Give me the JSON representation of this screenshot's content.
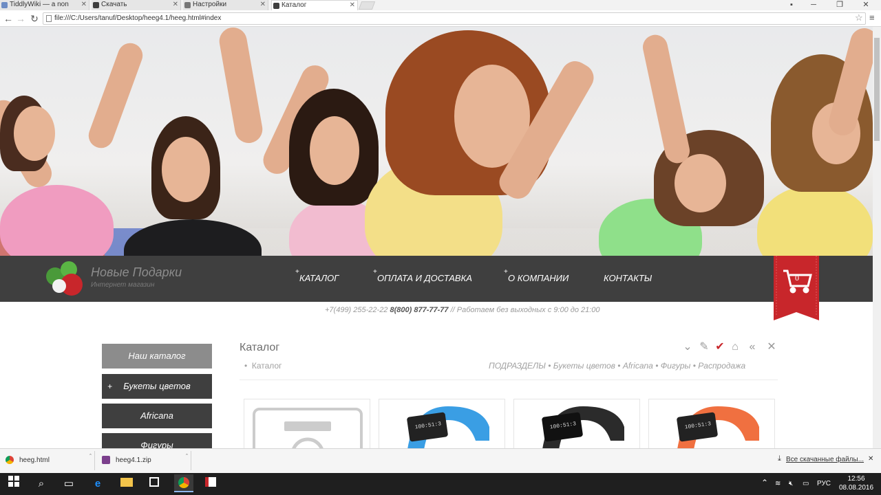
{
  "browser": {
    "tabs": [
      {
        "label": "TiddlyWiki — a non",
        "active": false,
        "icon_color": "#6d8cc4"
      },
      {
        "label": "Скачать",
        "active": false,
        "icon_color": "#3e3e3e"
      },
      {
        "label": "Настройки",
        "active": false,
        "icon_color": "#777777"
      },
      {
        "label": "Каталог",
        "active": true,
        "icon_color": "#3e3e3e"
      }
    ],
    "url": "file:///C:/Users/tanuf/Desktop/heeg4.1/heeg.html#index"
  },
  "site": {
    "logo_title": "Новые Подарки",
    "logo_subtitle": "Интернет магазин",
    "menu": [
      {
        "label": "КАТАЛОГ",
        "has_plus": true
      },
      {
        "label": "ОПЛАТА И ДОСТАВКА",
        "has_plus": true
      },
      {
        "label": "О КОМПАНИИ",
        "has_plus": true
      },
      {
        "label": "КОНТАКТЫ",
        "has_plus": false
      }
    ],
    "cart_count": "0",
    "phone1": "+7(499) 255-22-22",
    "phone2": "8(800) 877-77-77",
    "hours": "// Работаем без выходных с 9:00 до 21:00",
    "accent_color": "#c8262b"
  },
  "sidebar": {
    "items": [
      {
        "label": "Наш каталог",
        "style": "gray",
        "plus": false
      },
      {
        "label": "Букеты цветов",
        "style": "dark",
        "plus": true
      },
      {
        "label": "Africana",
        "style": "dark",
        "plus": false
      },
      {
        "label": "Фигуры",
        "style": "dark",
        "plus": false
      }
    ]
  },
  "catalog": {
    "title": "Каталог",
    "breadcrumb": "Каталог",
    "subsections_label": "ПОДРАЗДЕЛЫ",
    "subsections": [
      "Букеты цветов",
      "Africana",
      "Фигуры",
      "Распродажа"
    ],
    "products": [
      {
        "kind": "placeholder-camera",
        "color": "#cccccc"
      },
      {
        "kind": "fitness-band",
        "color": "#3a9ee4",
        "screen_text": "100:51:3"
      },
      {
        "kind": "fitness-band",
        "color": "#2b2b2b",
        "screen_text": "100:51:3"
      },
      {
        "kind": "fitness-band",
        "color": "#f07040",
        "screen_text": "100:51:3"
      }
    ]
  },
  "downloads": {
    "items": [
      {
        "label": "heeg.html",
        "icon": "chrome-icon"
      },
      {
        "label": "heeg4.1.zip",
        "icon": "zip-icon"
      }
    ],
    "show_all": "Все скачанные файлы..."
  },
  "taskbar": {
    "lang": "РУС",
    "time": "12:56",
    "date": "08.08.2016"
  }
}
